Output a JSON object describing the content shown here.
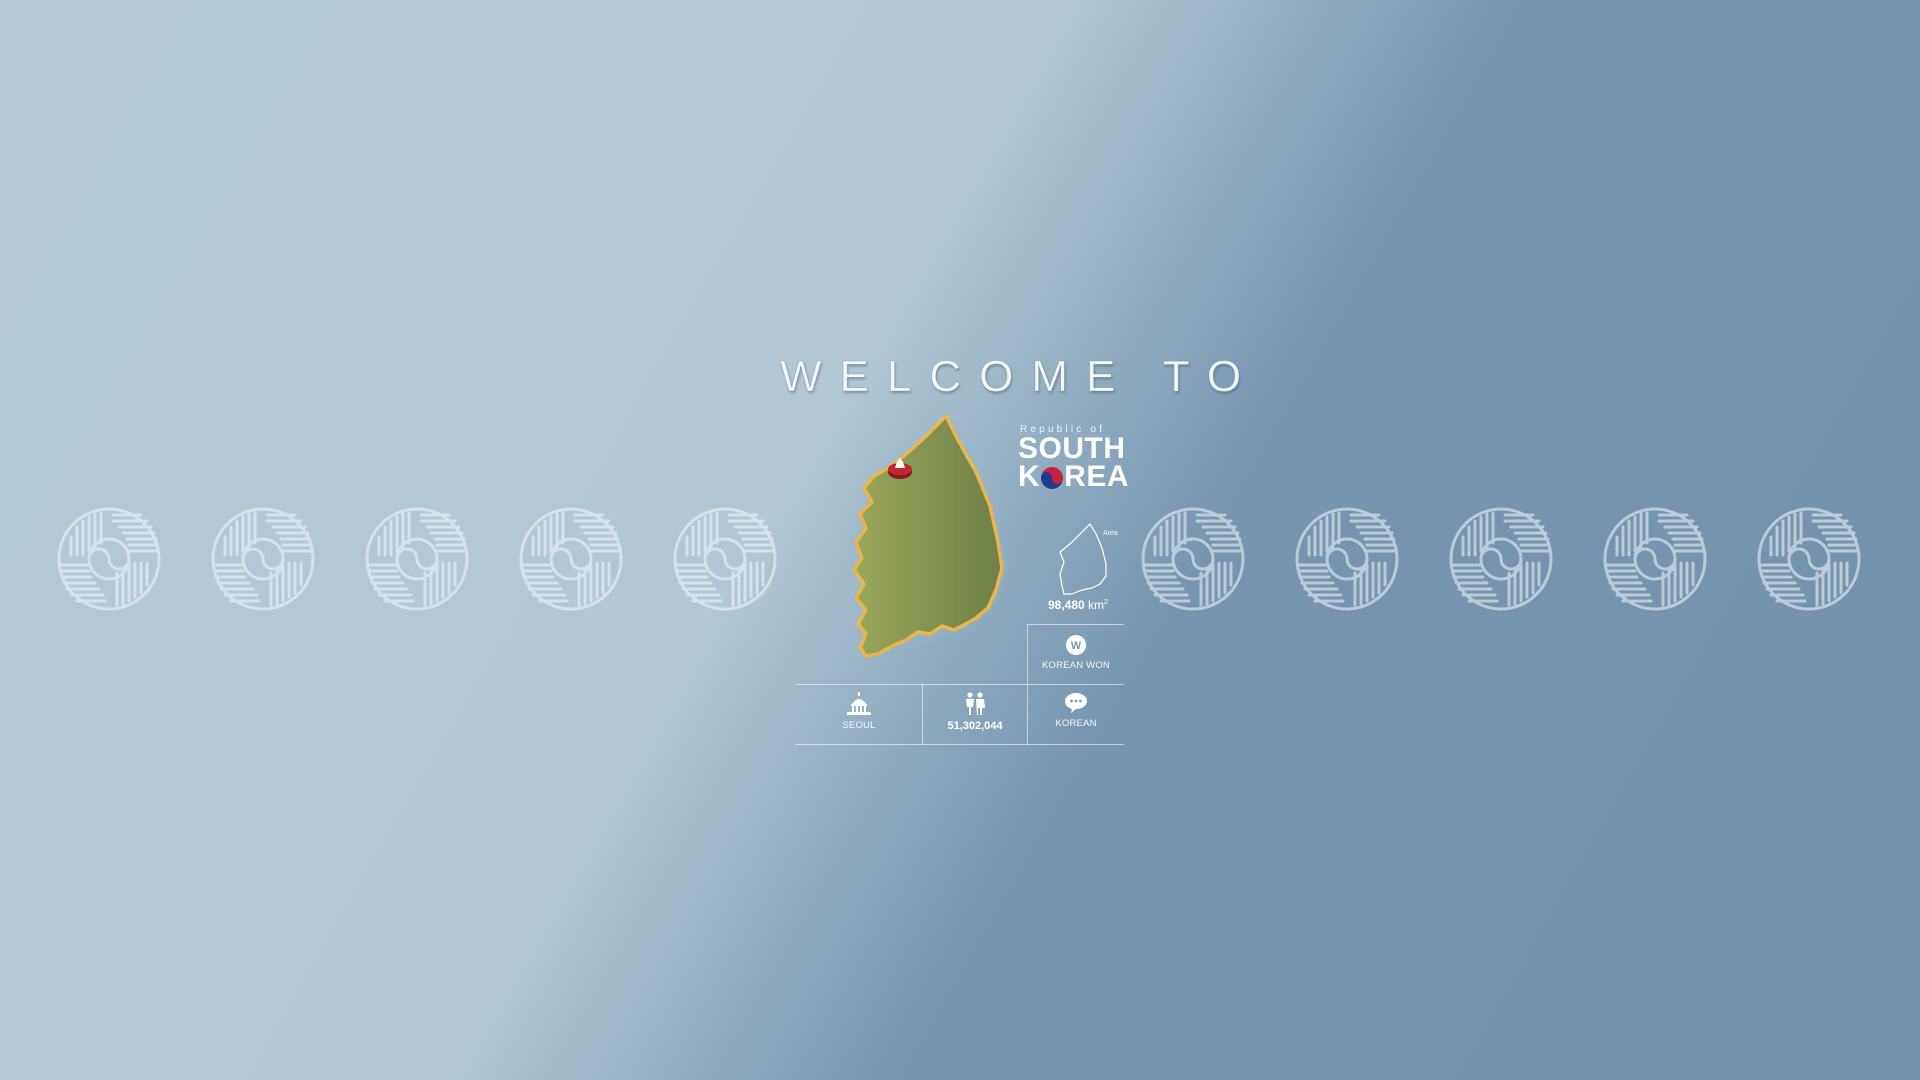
{
  "heading": "WELCOME TO",
  "country": {
    "prefix": "Republic of",
    "line1": "SOUTH",
    "line2_before_flag": "K",
    "line2_after_flag": "REA"
  },
  "area": {
    "caption": "Area",
    "value": "98,480",
    "unit": "km",
    "unit_superscript": "2"
  },
  "info": {
    "currency": {
      "icon": "won-coin-icon",
      "label": "KOREAN WON"
    },
    "capital": {
      "icon": "capitol-building-icon",
      "label": "SEOUL"
    },
    "population": {
      "icon": "people-icon",
      "value": "51,302,044"
    },
    "language": {
      "icon": "speech-bubble-icon",
      "label": "KOREAN"
    }
  },
  "colors": {
    "map_fill": "#8a9a4f",
    "map_outline": "#e8b54a",
    "marker": "#b0202a",
    "flag_red": "#c8213a",
    "flag_blue": "#1d3d8f"
  },
  "decor": {
    "medallion_icon": "taeguk-pattern-medallion-icon",
    "medallion_count": 10
  }
}
